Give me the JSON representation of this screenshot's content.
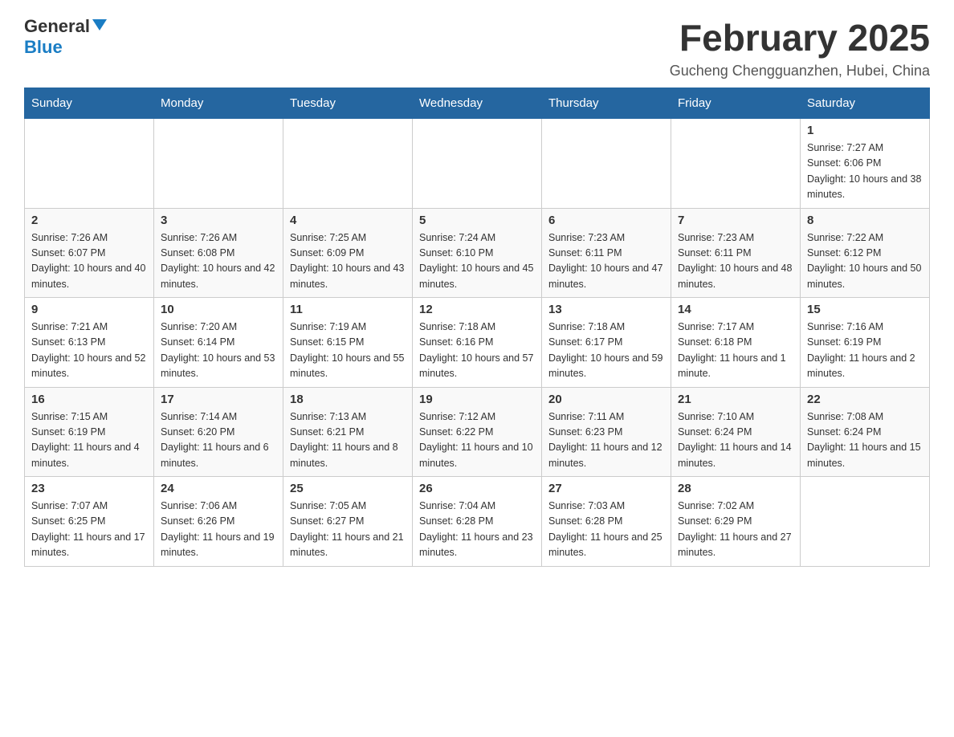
{
  "header": {
    "logo_general": "General",
    "logo_blue": "Blue",
    "title": "February 2025",
    "location": "Gucheng Chengguanzhen, Hubei, China"
  },
  "days_of_week": [
    "Sunday",
    "Monday",
    "Tuesday",
    "Wednesday",
    "Thursday",
    "Friday",
    "Saturday"
  ],
  "weeks": [
    [
      {
        "day": "",
        "info": ""
      },
      {
        "day": "",
        "info": ""
      },
      {
        "day": "",
        "info": ""
      },
      {
        "day": "",
        "info": ""
      },
      {
        "day": "",
        "info": ""
      },
      {
        "day": "",
        "info": ""
      },
      {
        "day": "1",
        "info": "Sunrise: 7:27 AM\nSunset: 6:06 PM\nDaylight: 10 hours and 38 minutes."
      }
    ],
    [
      {
        "day": "2",
        "info": "Sunrise: 7:26 AM\nSunset: 6:07 PM\nDaylight: 10 hours and 40 minutes."
      },
      {
        "day": "3",
        "info": "Sunrise: 7:26 AM\nSunset: 6:08 PM\nDaylight: 10 hours and 42 minutes."
      },
      {
        "day": "4",
        "info": "Sunrise: 7:25 AM\nSunset: 6:09 PM\nDaylight: 10 hours and 43 minutes."
      },
      {
        "day": "5",
        "info": "Sunrise: 7:24 AM\nSunset: 6:10 PM\nDaylight: 10 hours and 45 minutes."
      },
      {
        "day": "6",
        "info": "Sunrise: 7:23 AM\nSunset: 6:11 PM\nDaylight: 10 hours and 47 minutes."
      },
      {
        "day": "7",
        "info": "Sunrise: 7:23 AM\nSunset: 6:11 PM\nDaylight: 10 hours and 48 minutes."
      },
      {
        "day": "8",
        "info": "Sunrise: 7:22 AM\nSunset: 6:12 PM\nDaylight: 10 hours and 50 minutes."
      }
    ],
    [
      {
        "day": "9",
        "info": "Sunrise: 7:21 AM\nSunset: 6:13 PM\nDaylight: 10 hours and 52 minutes."
      },
      {
        "day": "10",
        "info": "Sunrise: 7:20 AM\nSunset: 6:14 PM\nDaylight: 10 hours and 53 minutes."
      },
      {
        "day": "11",
        "info": "Sunrise: 7:19 AM\nSunset: 6:15 PM\nDaylight: 10 hours and 55 minutes."
      },
      {
        "day": "12",
        "info": "Sunrise: 7:18 AM\nSunset: 6:16 PM\nDaylight: 10 hours and 57 minutes."
      },
      {
        "day": "13",
        "info": "Sunrise: 7:18 AM\nSunset: 6:17 PM\nDaylight: 10 hours and 59 minutes."
      },
      {
        "day": "14",
        "info": "Sunrise: 7:17 AM\nSunset: 6:18 PM\nDaylight: 11 hours and 1 minute."
      },
      {
        "day": "15",
        "info": "Sunrise: 7:16 AM\nSunset: 6:19 PM\nDaylight: 11 hours and 2 minutes."
      }
    ],
    [
      {
        "day": "16",
        "info": "Sunrise: 7:15 AM\nSunset: 6:19 PM\nDaylight: 11 hours and 4 minutes."
      },
      {
        "day": "17",
        "info": "Sunrise: 7:14 AM\nSunset: 6:20 PM\nDaylight: 11 hours and 6 minutes."
      },
      {
        "day": "18",
        "info": "Sunrise: 7:13 AM\nSunset: 6:21 PM\nDaylight: 11 hours and 8 minutes."
      },
      {
        "day": "19",
        "info": "Sunrise: 7:12 AM\nSunset: 6:22 PM\nDaylight: 11 hours and 10 minutes."
      },
      {
        "day": "20",
        "info": "Sunrise: 7:11 AM\nSunset: 6:23 PM\nDaylight: 11 hours and 12 minutes."
      },
      {
        "day": "21",
        "info": "Sunrise: 7:10 AM\nSunset: 6:24 PM\nDaylight: 11 hours and 14 minutes."
      },
      {
        "day": "22",
        "info": "Sunrise: 7:08 AM\nSunset: 6:24 PM\nDaylight: 11 hours and 15 minutes."
      }
    ],
    [
      {
        "day": "23",
        "info": "Sunrise: 7:07 AM\nSunset: 6:25 PM\nDaylight: 11 hours and 17 minutes."
      },
      {
        "day": "24",
        "info": "Sunrise: 7:06 AM\nSunset: 6:26 PM\nDaylight: 11 hours and 19 minutes."
      },
      {
        "day": "25",
        "info": "Sunrise: 7:05 AM\nSunset: 6:27 PM\nDaylight: 11 hours and 21 minutes."
      },
      {
        "day": "26",
        "info": "Sunrise: 7:04 AM\nSunset: 6:28 PM\nDaylight: 11 hours and 23 minutes."
      },
      {
        "day": "27",
        "info": "Sunrise: 7:03 AM\nSunset: 6:28 PM\nDaylight: 11 hours and 25 minutes."
      },
      {
        "day": "28",
        "info": "Sunrise: 7:02 AM\nSunset: 6:29 PM\nDaylight: 11 hours and 27 minutes."
      },
      {
        "day": "",
        "info": ""
      }
    ]
  ]
}
